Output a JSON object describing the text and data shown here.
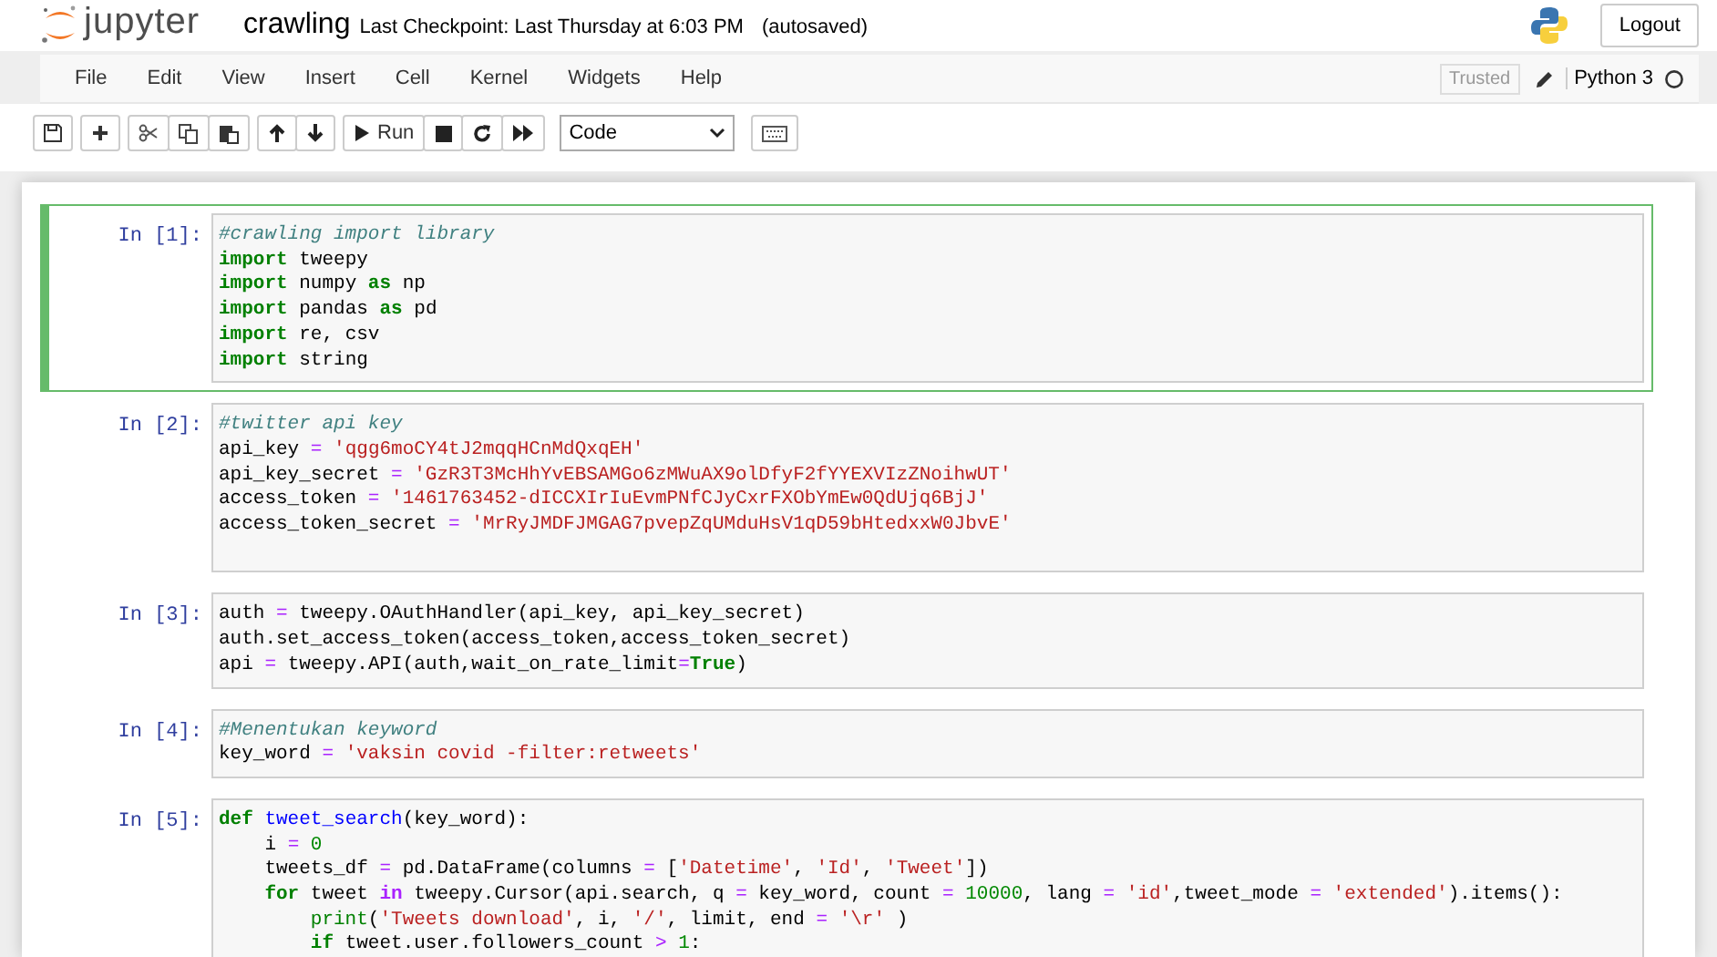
{
  "header": {
    "logo_text": "jupyter",
    "notebook_name": "crawling",
    "checkpoint": "Last Checkpoint: Last Thursday at 6:03 PM",
    "autosave": "(autosaved)",
    "logout": "Logout"
  },
  "menu": [
    "File",
    "Edit",
    "View",
    "Insert",
    "Cell",
    "Kernel",
    "Widgets",
    "Help"
  ],
  "status": {
    "trusted": "Trusted",
    "kernel": "Python 3"
  },
  "toolbar": {
    "run": "Run",
    "cell_type": "Code"
  },
  "cells": [
    {
      "prompt": "In [1]:",
      "selected": true,
      "lines": [
        {
          "kind": "code",
          "tokens": [
            {
              "kind": "comment",
              "text": "#crawling import library"
            }
          ]
        },
        {
          "kind": "code",
          "tokens": [
            {
              "kind": "keyword",
              "text": "import"
            },
            {
              "kind": "plain",
              "text": " tweepy"
            }
          ]
        },
        {
          "kind": "code",
          "tokens": [
            {
              "kind": "keyword",
              "text": "import"
            },
            {
              "kind": "plain",
              "text": " numpy "
            },
            {
              "kind": "keyword",
              "text": "as"
            },
            {
              "kind": "plain",
              "text": " np"
            }
          ]
        },
        {
          "kind": "code",
          "tokens": [
            {
              "kind": "keyword",
              "text": "import"
            },
            {
              "kind": "plain",
              "text": " pandas "
            },
            {
              "kind": "keyword",
              "text": "as"
            },
            {
              "kind": "plain",
              "text": " pd"
            }
          ]
        },
        {
          "kind": "code",
          "tokens": [
            {
              "kind": "keyword",
              "text": "import"
            },
            {
              "kind": "plain",
              "text": " re, csv"
            }
          ]
        },
        {
          "kind": "code",
          "tokens": [
            {
              "kind": "keyword",
              "text": "import"
            },
            {
              "kind": "plain",
              "text": " string"
            }
          ]
        }
      ]
    },
    {
      "prompt": "In [2]:",
      "selected": false,
      "lines": [
        {
          "kind": "code",
          "tokens": [
            {
              "kind": "comment",
              "text": "#twitter api key"
            }
          ]
        },
        {
          "kind": "code",
          "tokens": [
            {
              "kind": "plain",
              "text": "api_key "
            },
            {
              "kind": "operator",
              "text": "="
            },
            {
              "kind": "string",
              "text": " 'qgg6moCY4tJ2mqqHCnMdQxqEH'"
            }
          ]
        },
        {
          "kind": "code",
          "tokens": [
            {
              "kind": "plain",
              "text": "api_key_secret "
            },
            {
              "kind": "operator",
              "text": "="
            },
            {
              "kind": "string",
              "text": " 'GzR3T3McHhYvEBSAMGo6zMWuAX9olDfyF2fYYEXVIzZNoihwUT'"
            }
          ]
        },
        {
          "kind": "code",
          "tokens": [
            {
              "kind": "plain",
              "text": "access_token "
            },
            {
              "kind": "operator",
              "text": "="
            },
            {
              "kind": "string",
              "text": " '1461763452-dICCXIrIuEvmPNfCJyCxrFXObYmEw0QdUjq6BjJ'"
            }
          ]
        },
        {
          "kind": "code",
          "tokens": [
            {
              "kind": "plain",
              "text": "access_token_secret "
            },
            {
              "kind": "operator",
              "text": "="
            },
            {
              "kind": "string",
              "text": " 'MrRyJMDFJMGAG7pvepZqUMduHsV1qD59bHtedxxW0JbvE'"
            }
          ]
        },
        {
          "kind": "blank"
        }
      ]
    },
    {
      "prompt": "In [3]:",
      "selected": false,
      "lines": [
        {
          "kind": "code",
          "tokens": [
            {
              "kind": "plain",
              "text": "auth "
            },
            {
              "kind": "operator",
              "text": "="
            },
            {
              "kind": "plain",
              "text": " tweepy.OAuthHandler(api_key, api_key_secret)"
            }
          ]
        },
        {
          "kind": "code",
          "tokens": [
            {
              "kind": "plain",
              "text": "auth.set_access_token(access_token,access_token_secret)"
            }
          ]
        },
        {
          "kind": "code",
          "tokens": [
            {
              "kind": "plain",
              "text": "api "
            },
            {
              "kind": "operator",
              "text": "="
            },
            {
              "kind": "plain",
              "text": " tweepy.API(auth,wait_on_rate_limit"
            },
            {
              "kind": "operator",
              "text": "="
            },
            {
              "kind": "keyword",
              "text": "True"
            },
            {
              "kind": "plain",
              "text": ")"
            }
          ]
        }
      ]
    },
    {
      "prompt": "In [4]:",
      "selected": false,
      "lines": [
        {
          "kind": "code",
          "tokens": [
            {
              "kind": "comment",
              "text": "#Menentukan keyword"
            }
          ]
        },
        {
          "kind": "code",
          "tokens": [
            {
              "kind": "plain",
              "text": "key_word "
            },
            {
              "kind": "operator",
              "text": "="
            },
            {
              "kind": "string",
              "text": " 'vaksin covid -filter:retweets'"
            }
          ]
        }
      ]
    },
    {
      "prompt": "In [5]:",
      "selected": false,
      "lines": [
        {
          "kind": "code",
          "tokens": [
            {
              "kind": "keyword",
              "text": "def"
            },
            {
              "kind": "function",
              "text": " tweet_search"
            },
            {
              "kind": "plain",
              "text": "(key_word):"
            }
          ]
        },
        {
          "kind": "code",
          "tokens": [
            {
              "kind": "plain",
              "text": "    i "
            },
            {
              "kind": "operator",
              "text": "="
            },
            {
              "kind": "number",
              "text": " 0"
            }
          ]
        },
        {
          "kind": "code",
          "tokens": [
            {
              "kind": "plain",
              "text": "    tweets_df "
            },
            {
              "kind": "operator",
              "text": "="
            },
            {
              "kind": "plain",
              "text": " pd.DataFrame(columns "
            },
            {
              "kind": "operator",
              "text": "="
            },
            {
              "kind": "plain",
              "text": " ["
            },
            {
              "kind": "string",
              "text": "'Datetime'"
            },
            {
              "kind": "plain",
              "text": ", "
            },
            {
              "kind": "string",
              "text": "'Id'"
            },
            {
              "kind": "plain",
              "text": ", "
            },
            {
              "kind": "string",
              "text": "'Tweet'"
            },
            {
              "kind": "plain",
              "text": "])"
            }
          ]
        },
        {
          "kind": "code",
          "tokens": [
            {
              "kind": "keyword",
              "text": "    for"
            },
            {
              "kind": "plain",
              "text": " tweet "
            },
            {
              "kind": "op_word",
              "text": "in"
            },
            {
              "kind": "plain",
              "text": " tweepy.Cursor(api.search, q "
            },
            {
              "kind": "operator",
              "text": "="
            },
            {
              "kind": "plain",
              "text": " key_word, count "
            },
            {
              "kind": "operator",
              "text": "="
            },
            {
              "kind": "number",
              "text": " 10000"
            },
            {
              "kind": "plain",
              "text": ", lang "
            },
            {
              "kind": "operator",
              "text": "="
            },
            {
              "kind": "string",
              "text": " 'id'"
            },
            {
              "kind": "plain",
              "text": ",tweet_mode "
            },
            {
              "kind": "operator",
              "text": "="
            },
            {
              "kind": "string",
              "text": " 'extended'"
            },
            {
              "kind": "plain",
              "text": ").items():"
            }
          ]
        },
        {
          "kind": "code",
          "tokens": [
            {
              "kind": "builtin",
              "text": "        print"
            },
            {
              "kind": "plain",
              "text": "("
            },
            {
              "kind": "string",
              "text": "'Tweets download'"
            },
            {
              "kind": "plain",
              "text": ", i, "
            },
            {
              "kind": "string",
              "text": "'/'"
            },
            {
              "kind": "plain",
              "text": ", limit, end "
            },
            {
              "kind": "operator",
              "text": "="
            },
            {
              "kind": "string",
              "text": " '\\r'"
            },
            {
              "kind": "plain",
              "text": " )"
            }
          ]
        },
        {
          "kind": "code",
          "tokens": [
            {
              "kind": "keyword",
              "text": "        if"
            },
            {
              "kind": "plain",
              "text": " tweet.user.followers_count "
            },
            {
              "kind": "operator",
              "text": ">"
            },
            {
              "kind": "number",
              "text": " 1"
            },
            {
              "kind": "plain",
              "text": ":"
            }
          ]
        }
      ]
    }
  ]
}
